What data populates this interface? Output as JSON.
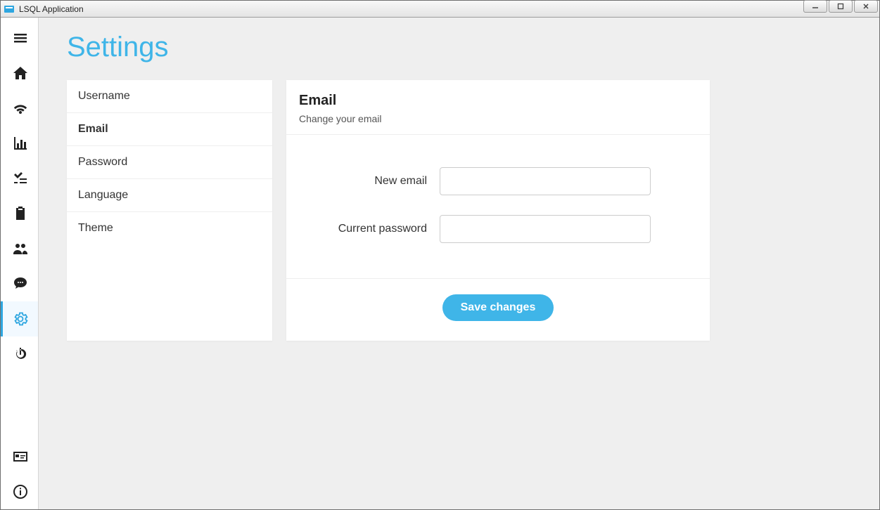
{
  "window": {
    "title": "LSQL Application"
  },
  "sidebar": {
    "items": [
      {
        "name": "menu-icon"
      },
      {
        "name": "home-icon"
      },
      {
        "name": "wifi-icon"
      },
      {
        "name": "bar-chart-icon"
      },
      {
        "name": "checklist-icon"
      },
      {
        "name": "clipboard-icon"
      },
      {
        "name": "users-icon"
      },
      {
        "name": "chat-icon"
      },
      {
        "name": "gear-icon",
        "active": true
      },
      {
        "name": "power-icon"
      }
    ],
    "bottom_items": [
      {
        "name": "card-icon"
      },
      {
        "name": "info-icon"
      }
    ]
  },
  "page": {
    "title": "Settings",
    "tabs": [
      {
        "label": "Username"
      },
      {
        "label": "Email",
        "active": true
      },
      {
        "label": "Password"
      },
      {
        "label": "Language"
      },
      {
        "label": "Theme"
      }
    ],
    "panel": {
      "title": "Email",
      "subtitle": "Change your email",
      "fields": {
        "new_email": {
          "label": "New email",
          "value": ""
        },
        "current_password": {
          "label": "Current password",
          "value": ""
        }
      },
      "save_label": "Save changes"
    }
  },
  "colors": {
    "accent": "#3fb5e8"
  }
}
